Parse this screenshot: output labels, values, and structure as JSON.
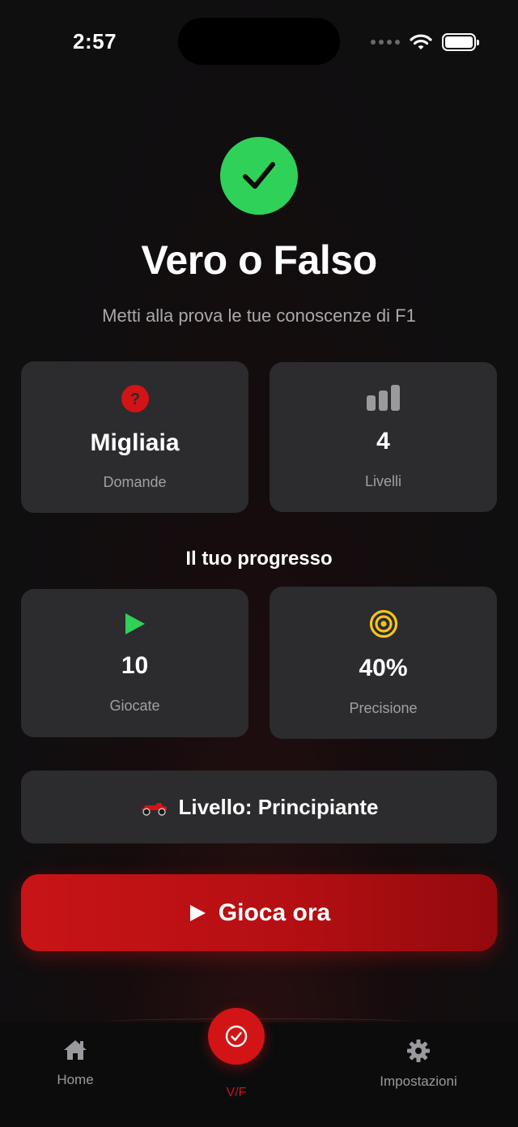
{
  "status_bar": {
    "time": "2:57"
  },
  "hero": {
    "title": "Vero o Falso",
    "subtitle": "Metti alla prova le tue conoscenze di F1",
    "icon": "checkmark-circle-icon",
    "icon_color": "#30d158"
  },
  "info_cards": [
    {
      "value": "Migliaia",
      "label": "Domande",
      "icon": "question-circle-icon",
      "icon_color": "#d21417"
    },
    {
      "value": "4",
      "label": "Livelli",
      "icon": "bar-chart-icon",
      "icon_color": "#9a9a9e"
    }
  ],
  "progress": {
    "title": "Il tuo progresso",
    "cards": [
      {
        "value": "10",
        "label": "Giocate",
        "icon": "play-icon",
        "icon_color": "#30d158"
      },
      {
        "value": "40%",
        "label": "Precisione",
        "icon": "target-icon",
        "icon_color": "#f5c518"
      }
    ]
  },
  "level": {
    "text": "Livello: Principiante",
    "icon": "race-car-icon"
  },
  "play_button": {
    "label": "Gioca ora",
    "color": "#c81417"
  },
  "tab_bar": {
    "items": [
      {
        "label": "Home",
        "icon": "home-icon"
      },
      {
        "label": "V/F",
        "icon": "checkmark-circle-icon",
        "active": true
      },
      {
        "label": "Impostazioni",
        "icon": "gear-icon"
      }
    ],
    "accent": "#c81417"
  }
}
